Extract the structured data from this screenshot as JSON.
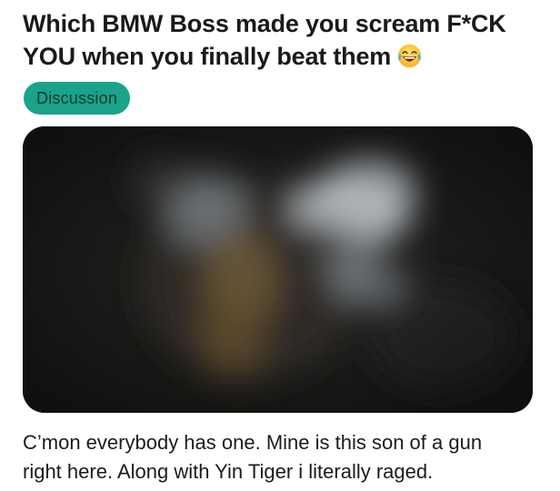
{
  "post": {
    "title_line1": "Which BMW Boss made you scream F*CK",
    "title_line2": "YOU when you finally beat them",
    "title_emoji": "tears-of-joy-emoji",
    "flair": {
      "label": "Discussion",
      "color": "#1aa38a"
    },
    "media": {
      "type": "blurred-image",
      "icon": "blurred-spoiler-image"
    },
    "body_line1": "C’mon everybody has one. Mine is this son of a gun",
    "body_line2": "right here. Along with Yin Tiger i literally raged."
  }
}
